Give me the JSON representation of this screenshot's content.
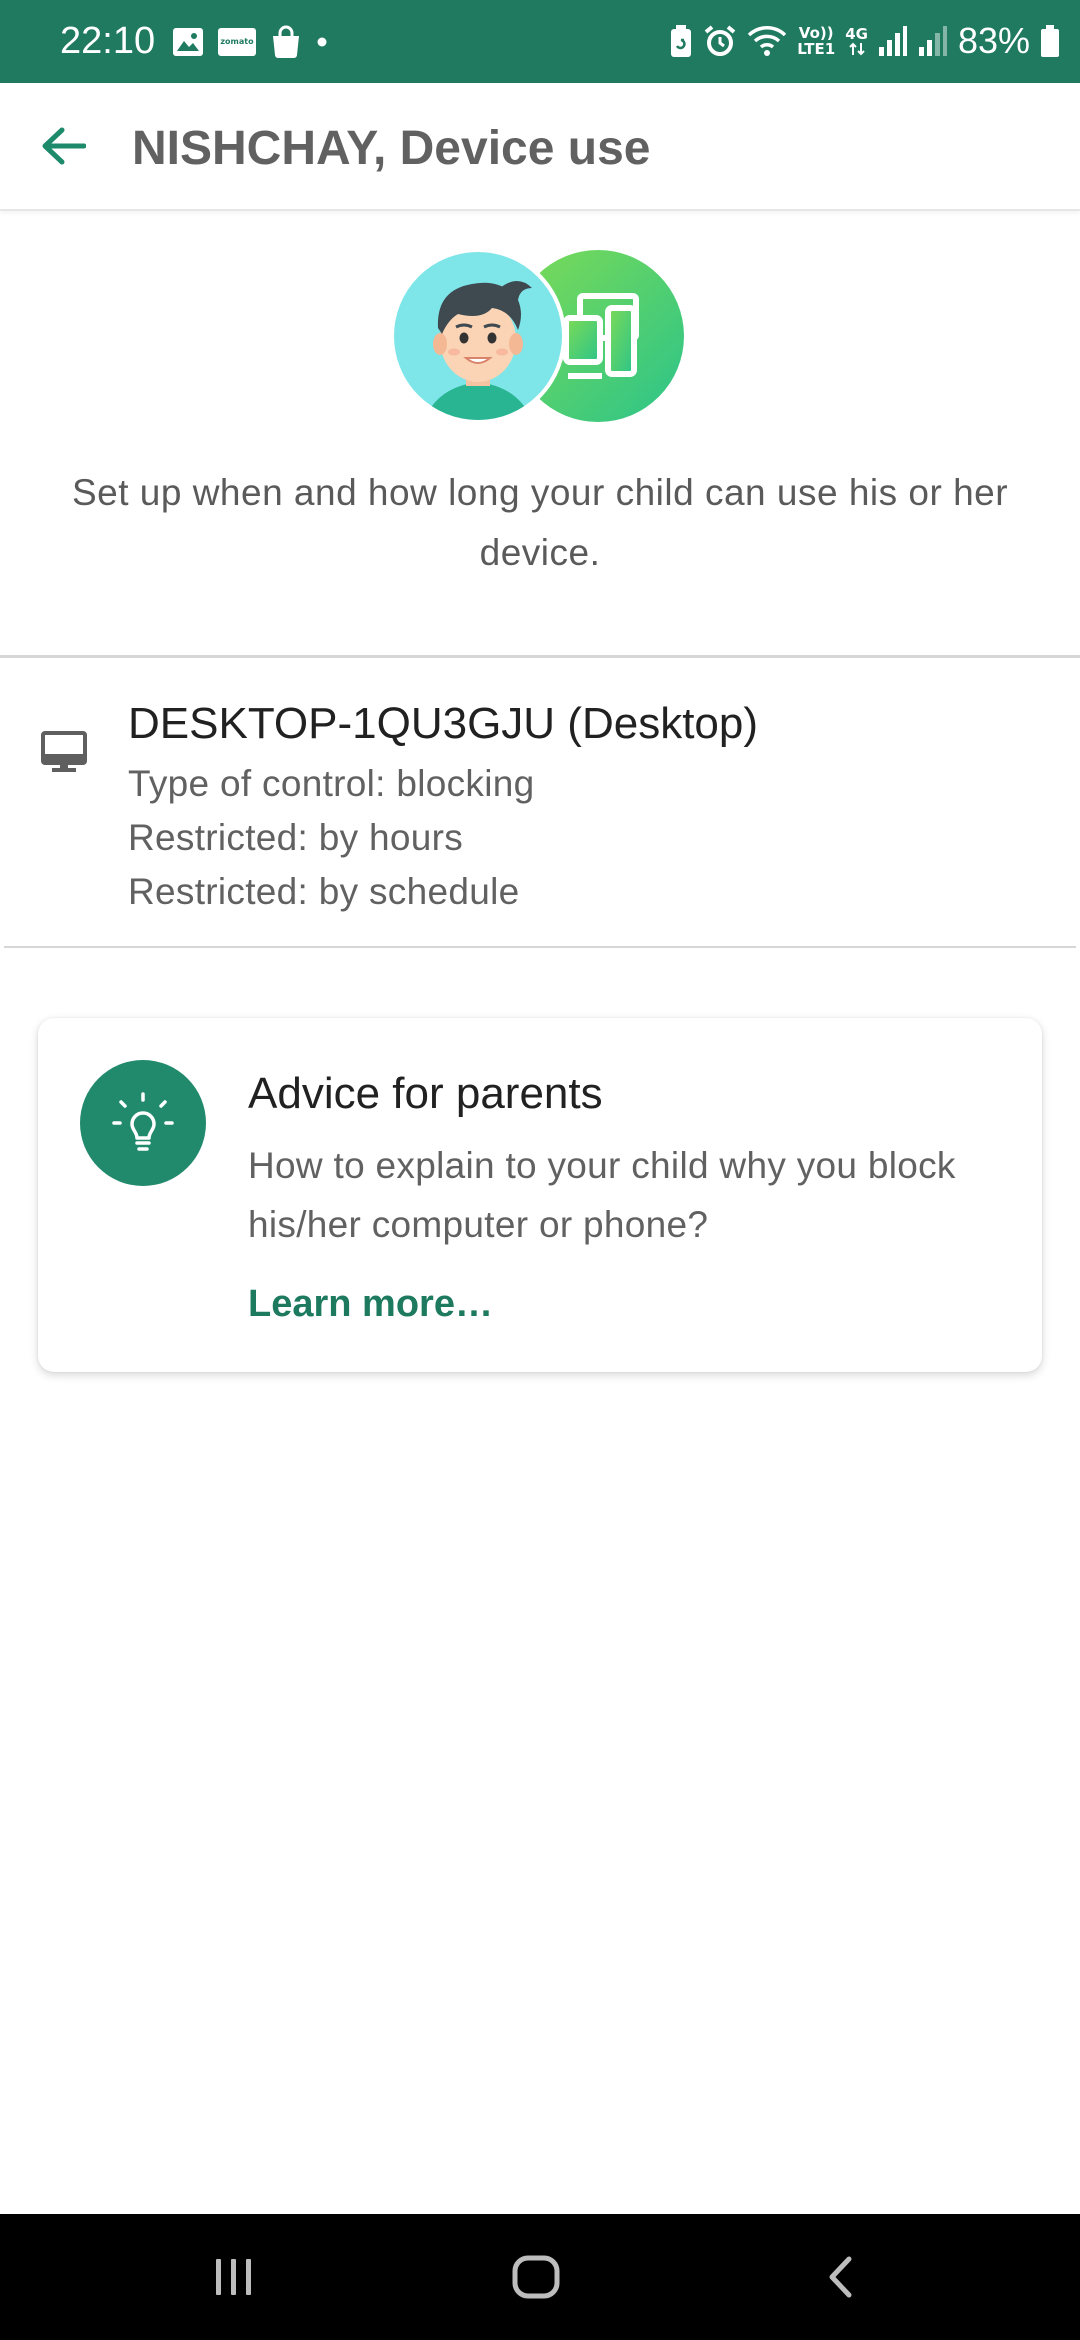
{
  "status_bar": {
    "time": "22:10",
    "battery_percent": "83%",
    "volte_line1": "Vo))",
    "volte_line2": "LTE1",
    "network_type": "4G",
    "zomato_label": "zomato",
    "background_color": "#1f7a60",
    "left_icons": [
      "gallery-icon",
      "zomato-icon",
      "shopping-bag-icon",
      "notification-dot-icon"
    ],
    "right_icons": [
      "battery-saver-icon",
      "alarm-icon",
      "wifi-icon",
      "volte-icon",
      "4g-icon",
      "signal-icon",
      "signal-weak-icon",
      "battery-icon"
    ]
  },
  "app_bar": {
    "title": "NISHCHAY, Device use",
    "back_icon": "arrow-back-icon",
    "accent_color": "#1d8a6b"
  },
  "hero": {
    "description": "Set up when and how long your child can use his or her device.",
    "illustration": "child-avatar-with-devices-icon"
  },
  "device": {
    "icon": "desktop-monitor-icon",
    "name": "DESKTOP-1QU3GJU (Desktop)",
    "details": [
      "Type of control: blocking",
      "Restricted: by hours",
      "Restricted: by schedule"
    ]
  },
  "advice": {
    "icon": "lightbulb-icon",
    "title": "Advice for parents",
    "body": "How to explain to your child why you block his/her computer or phone?",
    "link": "Learn more…",
    "link_color": "#1d7a5f"
  },
  "nav_bar": {
    "buttons": [
      "recent-apps-icon",
      "home-icon",
      "back-icon"
    ]
  }
}
